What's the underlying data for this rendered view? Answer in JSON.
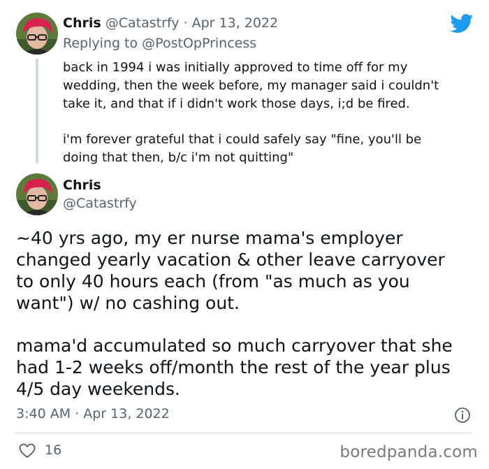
{
  "reply_tweet": {
    "name": "Chris",
    "handle": "@Catastrfy",
    "separator": "·",
    "date": "Apr 13, 2022",
    "replying_prefix": "Replying to",
    "replying_to": "@PostOpPrincess",
    "body_lines": [
      "back in 1994 i was initially approved to time off for my",
      "wedding, then the week before, my manager said i couldn't",
      "take it, and that if i didn't work those days, i;d be fired.",
      "",
      "i'm forever grateful that i could safely say \"fine, you'll be",
      "doing that then, b/c i'm not quitting\""
    ]
  },
  "main_tweet": {
    "name": "Chris",
    "handle": "@Catastrfy",
    "body_lines": [
      "~40 yrs ago, my er nurse mama's employer",
      "changed yearly vacation & other leave carryover",
      "to only 40 hours each (from \"as much as you",
      "want\") w/ no cashing out.",
      "",
      "mama'd accumulated so much carryover that she",
      "had 1-2 weeks off/month the rest of the year plus",
      "4/5 day weekends."
    ],
    "time": "3:40 AM",
    "separator": "·",
    "date": "Apr 13, 2022",
    "like_count": "16"
  },
  "icons": {
    "brand": "twitter-bird-icon",
    "info": "info-icon",
    "like": "heart-icon"
  },
  "watermark": "boredpanda.com",
  "colors": {
    "twitter_blue": "#1d9bf0",
    "text": "#0f1419",
    "secondary": "#536471",
    "divider": "#cfd9de",
    "avatar_hair": "#d8224e"
  }
}
